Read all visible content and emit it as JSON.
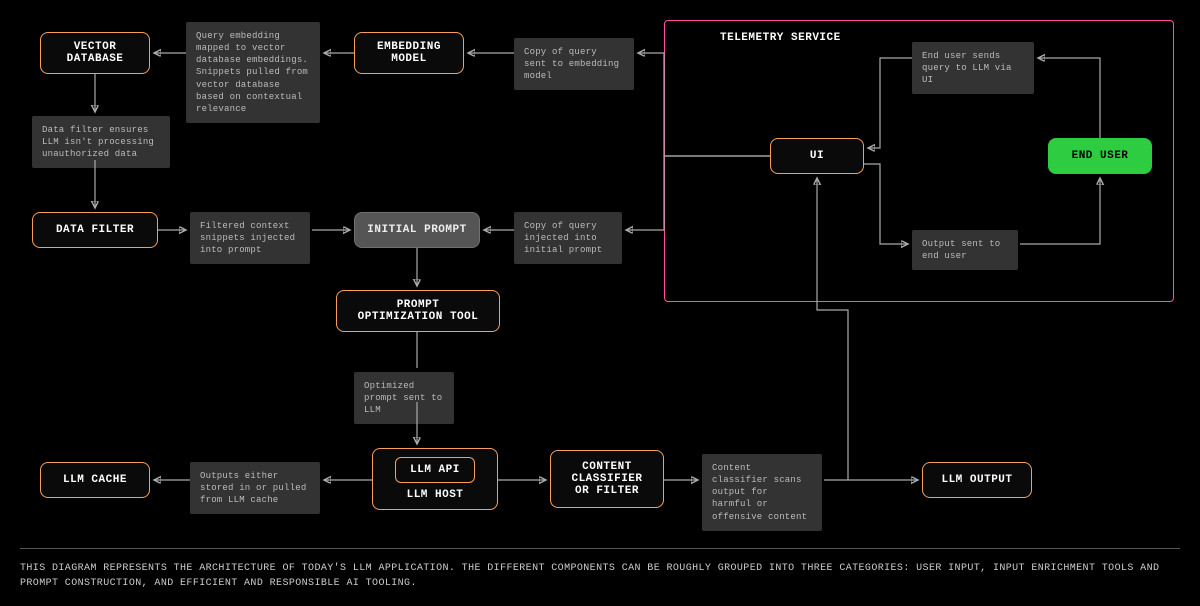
{
  "nodes": {
    "vector_db": "VECTOR\nDATABASE",
    "embedding": "EMBEDDING\nMODEL",
    "ui": "UI",
    "end_user": "END USER",
    "data_filter": "DATA FILTER",
    "initial_prompt": "INITIAL PROMPT",
    "prompt_opt": "PROMPT\nOPTIMIZATION TOOL",
    "llm_cache": "LLM CACHE",
    "llm_api": "LLM API",
    "llm_host": "LLM  HOST",
    "content_classifier": "CONTENT\nCLASSIFIER\nOR FILTER",
    "llm_output": "LLM OUTPUT"
  },
  "notes": {
    "query_embed": "Query embedding mapped to vector database embeddings. Snippets pulled from vector database based on contextual relevance",
    "copy_embed": "Copy of query sent to embedding model",
    "send_query": "End user sends query to LLM via UI",
    "data_filter_note": "Data filter ensures LLM isn't processing unauthorized data",
    "filtered_ctx": "Filtered context snippets injected into prompt",
    "copy_initial": "Copy of query injected into initial prompt",
    "output_sent": "Output sent to end user",
    "opt_prompt": "Optimized prompt sent to LLM",
    "outputs_cache": "Outputs either stored in or pulled from LLM cache",
    "classifier_scan": "Content classifier scans output for harmful or offensive content"
  },
  "telemetry_label": "TELEMETRY SERVICE",
  "footer": "THIS DIAGRAM REPRESENTS THE ARCHITECTURE OF TODAY'S LLM APPLICATION. THE DIFFERENT COMPONENTS CAN BE ROUGHLY GROUPED INTO THREE CATEGORIES: USER INPUT, INPUT ENRICHMENT TOOLS AND PROMPT CONSTRUCTION, AND EFFICIENT AND RESPONSIBLE AI TOOLING."
}
